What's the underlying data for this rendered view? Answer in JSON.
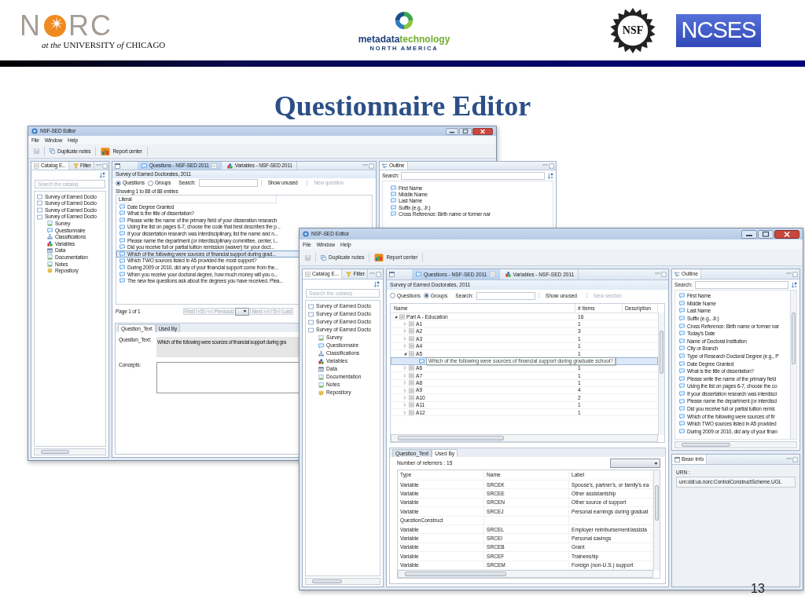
{
  "slide": {
    "title": "Questionnaire Editor",
    "page_number": "13"
  },
  "logos": {
    "norc": {
      "left": "N",
      "right": "RC",
      "subtitle": "*at the* UNIVERSITY *of* CHICAGO"
    },
    "mtna": {
      "word_a": "metadata",
      "word_b": "technology",
      "line2": "NORTH AMERICA"
    },
    "nsf": {
      "text": "NSF"
    },
    "ncses": {
      "text": "NCSES"
    }
  },
  "back_window": {
    "title": "NSF-SED Editor",
    "menu": [
      "File",
      "Window",
      "Help"
    ],
    "toolbar": [
      "Duplicate notes",
      "Report center"
    ],
    "catalog": {
      "tabs": [
        {
          "label": "Catalog E...",
          "kind": "catalog",
          "selected": true
        },
        {
          "label": "Filter",
          "kind": "filter",
          "selected": false
        }
      ],
      "search_placeholder": "Search the catalog",
      "tree": [
        {
          "label": "Survey of Earned Docto",
          "kind": "book"
        },
        {
          "label": "Survey of Earned Docto",
          "kind": "book"
        },
        {
          "label": "Survey of Earned Docto",
          "kind": "book"
        },
        {
          "label": "Survey of Earned Docto",
          "kind": "book",
          "children": [
            {
              "label": "Survey",
              "kind": "survey"
            },
            {
              "label": "Questionnaire",
              "kind": "questionnaire"
            },
            {
              "label": "Classifications",
              "kind": "classifications"
            },
            {
              "label": "Variables",
              "kind": "variables"
            },
            {
              "label": "Data",
              "kind": "data"
            },
            {
              "label": "Documentation",
              "kind": "documentation"
            },
            {
              "label": "Notes",
              "kind": "notes"
            },
            {
              "label": "Repository",
              "kind": "repository"
            }
          ]
        }
      ]
    },
    "editor": {
      "tabs": [
        {
          "label": "Questions - NSF-SED 2011",
          "kind": "questions",
          "selected": true
        },
        {
          "label": "Variables - NSF-SED 2011",
          "kind": "variables",
          "selected": false
        }
      ],
      "heading": "Survey of Earned Doctorates, 2011",
      "modes": [
        {
          "label": "Questions",
          "selected": true
        },
        {
          "label": "Groups",
          "selected": false
        }
      ],
      "search_label": "Search:",
      "buttons": [
        {
          "label": "Show unused",
          "disabled": false
        },
        {
          "label": "New question",
          "disabled": true
        }
      ],
      "count": "Showing 1 to 88 of 88 entries",
      "column": "Literal",
      "rows": [
        {
          "text": "Date Degree Granted",
          "selected": false
        },
        {
          "text": "What is the title of dissertation?",
          "selected": false
        },
        {
          "text": "Please write the name of the primary field of your disseration research",
          "selected": false
        },
        {
          "text": "Using the list on pages 6-7, choose the code that best describes the p...",
          "selected": false
        },
        {
          "text": "If your dissertation research was interdisciplinary, list the name and n...",
          "selected": false
        },
        {
          "text": "Please name the department (or interdisciplinary committee, center, i...",
          "selected": false
        },
        {
          "text": "Did you receive full or partial tuition remission (waiver) for your doct...",
          "selected": false
        },
        {
          "text": "Which of the following were sources of financial support during grad...",
          "selected": true
        },
        {
          "text": "Which TWO sources listed in A5 provided the most support?",
          "selected": false
        },
        {
          "text": "During 2009 or 2010, did any of your financial support come from the...",
          "selected": false
        },
        {
          "text": "When you receive your doctoral degree, how much money will you o...",
          "selected": false
        },
        {
          "text": "The new few questions ask about the degrees you have received. Plea...",
          "selected": false
        }
      ],
      "pager": {
        "page": "Page 1 of 1",
        "before": [
          "First",
          "<5",
          "<< Previous"
        ],
        "after": [
          "Next >>",
          "5>",
          "Last"
        ]
      },
      "detail_tabs": [
        {
          "label": "Question_Text",
          "selected": true
        },
        {
          "label": "Used By",
          "selected": false
        }
      ],
      "question_label": "Question_Text:",
      "question_text": "Which of the following were sources of financial support during gra",
      "concepts_label": "Concepts:"
    },
    "outline": {
      "tab": "Outline",
      "search_label": "Search:",
      "items": [
        "First Name",
        "Middle Name",
        "Last Name",
        "Suffix (e.g., Jr.)",
        "Cross Reference: Birth name or former nar"
      ]
    }
  },
  "front_window": {
    "title": "NSF-SED Editor",
    "menu": [
      "File",
      "Window",
      "Help"
    ],
    "toolbar": [
      "Duplicate notes",
      "Report center"
    ],
    "catalog": {
      "tabs": [
        {
          "label": "Catalog E...",
          "kind": "catalog",
          "selected": true
        },
        {
          "label": "Filter",
          "kind": "filter",
          "selected": false
        }
      ],
      "search_placeholder": "Search the catalog",
      "tree": [
        {
          "label": "Survey of Earned Docto",
          "kind": "book"
        },
        {
          "label": "Survey of Earned Docto",
          "kind": "book"
        },
        {
          "label": "Survey of Earned Docto",
          "kind": "book"
        },
        {
          "label": "Survey of Earned Docto",
          "kind": "book",
          "children": [
            {
              "label": "Survey",
              "kind": "survey"
            },
            {
              "label": "Questionnaire",
              "kind": "questionnaire"
            },
            {
              "label": "Classifications",
              "kind": "classifications"
            },
            {
              "label": "Variables",
              "kind": "variables"
            },
            {
              "label": "Data",
              "kind": "data"
            },
            {
              "label": "Documentation",
              "kind": "documentation"
            },
            {
              "label": "Notes",
              "kind": "notes"
            },
            {
              "label": "Repository",
              "kind": "repository"
            }
          ]
        }
      ]
    },
    "editor": {
      "tabs": [
        {
          "label": "Questions - NSF-SED 2011",
          "kind": "questions",
          "selected": true
        },
        {
          "label": "Variables - NSF-SED 2011",
          "kind": "variables",
          "selected": false
        }
      ],
      "heading": "Survey of Earned Doctorates, 2011",
      "modes": [
        {
          "label": "Questions",
          "selected": false
        },
        {
          "label": "Groups",
          "selected": true
        }
      ],
      "search_label": "Search:",
      "buttons": [
        {
          "label": "Show unused",
          "disabled": false
        },
        {
          "label": "New section",
          "disabled": true
        }
      ],
      "columns": [
        "Name",
        "# Items",
        "Description"
      ],
      "groups": [
        {
          "label": "Part A - Education",
          "items": "16",
          "kind": "group",
          "expanded": true,
          "selected": false,
          "children": [
            {
              "label": "A1",
              "items": "1",
              "kind": "group",
              "expanded": false,
              "selected": false
            },
            {
              "label": "A2",
              "items": "3",
              "kind": "group",
              "expanded": false,
              "selected": false
            },
            {
              "label": "A3",
              "items": "1",
              "kind": "group",
              "expanded": false,
              "selected": false
            },
            {
              "label": "A4",
              "items": "1",
              "kind": "group",
              "expanded": false,
              "selected": false
            },
            {
              "label": "A5",
              "items": "1",
              "kind": "group",
              "expanded": true,
              "selected": false,
              "children": [
                {
                  "label": "Which of the following were sources of financial support during graduate school?",
                  "kind": "question",
                  "selected": true
                }
              ]
            },
            {
              "label": "A6",
              "items": "1",
              "kind": "group",
              "expanded": false,
              "selected": false
            },
            {
              "label": "A7",
              "items": "1",
              "kind": "group",
              "expanded": false,
              "selected": false
            },
            {
              "label": "A8",
              "items": "1",
              "kind": "group",
              "expanded": false,
              "selected": false
            },
            {
              "label": "A9",
              "items": "4",
              "kind": "group",
              "expanded": false,
              "selected": false
            },
            {
              "label": "A10",
              "items": "2",
              "kind": "group",
              "expanded": false,
              "selected": false
            },
            {
              "label": "A11",
              "items": "1",
              "kind": "group",
              "expanded": false,
              "selected": false
            },
            {
              "label": "A12",
              "items": "1",
              "kind": "group",
              "expanded": false,
              "selected": false
            }
          ]
        }
      ],
      "detail_tabs": [
        {
          "label": "Question_Text",
          "selected": false
        },
        {
          "label": "Used By",
          "selected": true
        }
      ],
      "referrers": "Number of referrers : 15",
      "used_columns": [
        "Type",
        "Name",
        "Label"
      ],
      "used_rows": [
        {
          "type": "Variable",
          "name": "SRCEK",
          "label": "Spouse's, partner's, or family's ea"
        },
        {
          "type": "Variable",
          "name": "SRCEE",
          "label": "Other assistantship"
        },
        {
          "type": "Variable",
          "name": "SRCEN",
          "label": "Other source of support"
        },
        {
          "type": "Variable",
          "name": "SRCEJ",
          "label": "Personal earnings during graduat"
        },
        {
          "type": "QuestionConstruct"
        },
        {
          "type": "Variable",
          "name": "SRCEL",
          "label": "Employer reimbursement/assista"
        },
        {
          "type": "Variable",
          "name": "SRCEI",
          "label": "Personal savings"
        },
        {
          "type": "Variable",
          "name": "SRCEB",
          "label": "Grant"
        },
        {
          "type": "Variable",
          "name": "SRCEF",
          "label": "Traineeship"
        },
        {
          "type": "Variable",
          "name": "SRCEM",
          "label": "Foreign (non-U.S.) support"
        }
      ]
    },
    "outline": {
      "tab": "Outline",
      "search_label": "Search:",
      "items": [
        "First Name",
        "Middle Name",
        "Last Name",
        "Suffix (e.g., Jr.)",
        "Cross Reference: Birth name or former nar",
        "Today's Date",
        "Name of Doctoral Institution",
        "City or Branch",
        "Type of Research Doctoral Degree (e.g., P",
        "Date Degree Granted",
        "What is the title of dissertation?",
        "Please write the name of the primary field",
        "Using the list on pages 6-7, choose the co",
        "If your dissertation research was interdisci",
        "Please name the department (or interdisci",
        "Did you receive full or partial tuition remis",
        "Which of the following were sources of fir",
        "Which TWO sources listed in A5 provided",
        "During 2009 or 2010, did any of your finan"
      ]
    },
    "bean_info": {
      "tab": "Bean Info",
      "label": "URN :",
      "value": "urn:ddi:us.norc:ControlConstructScheme.UGL"
    }
  }
}
